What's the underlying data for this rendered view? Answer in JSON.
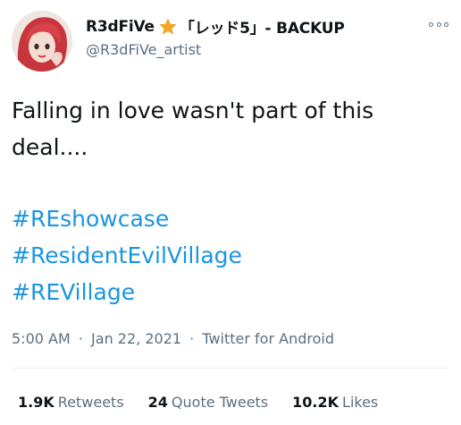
{
  "tweet": {
    "display_name_before": "R3dFiVe",
    "display_name_after": "「レッド5」- BACKUP",
    "name_emoji": "star-emoji",
    "handle": "@R3dFiVe_artist",
    "text": "Falling in love wasn't part of this\ndeal....",
    "hashtags": [
      "#REshowcase",
      "#ResidentEvilVillage",
      "#REVillage"
    ],
    "time": "5:00 AM",
    "date": "Jan 22, 2021",
    "source": "Twitter for Android",
    "separator": "·"
  },
  "stats": [
    {
      "count": "1.9K",
      "label": "Retweets"
    },
    {
      "count": "24",
      "label": "Quote Tweets"
    },
    {
      "count": "10.2K",
      "label": "Likes"
    }
  ],
  "colors": {
    "text": "#0f1419",
    "secondary": "#5b7083",
    "link": "#1b95e0",
    "divider": "#ebeef0",
    "star": "#f5a623"
  },
  "icons": [
    "avatar-illustration",
    "star-emoji",
    "more-options-icon"
  ]
}
